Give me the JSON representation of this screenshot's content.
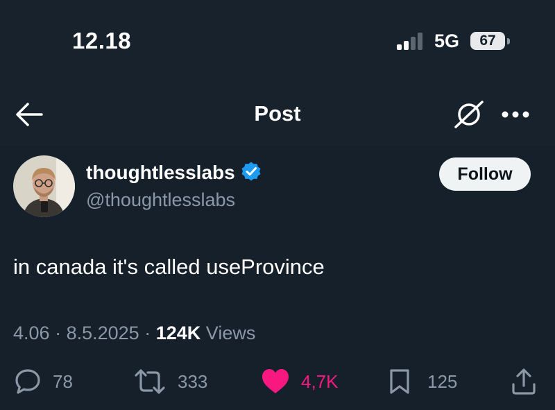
{
  "status_bar": {
    "time": "12.18",
    "network": "5G",
    "battery": "67"
  },
  "header": {
    "title": "Post",
    "back_icon": "arrow-left-icon",
    "grok_icon": "grok-icon",
    "more_icon": "ellipsis-icon"
  },
  "author": {
    "display_name": "thoughtlesslabs",
    "handle": "@thoughtlesslabs",
    "verified": true,
    "follow_label": "Follow"
  },
  "tweet": {
    "text": "in canada it's called useProvince"
  },
  "meta": {
    "time": "4.06",
    "date": "8.5.2025",
    "views_count": "124K",
    "views_label": "Views"
  },
  "actions": {
    "replies": "78",
    "reposts": "333",
    "likes": "4,7K",
    "bookmarks": "125"
  },
  "colors": {
    "background": "#15202b",
    "like": "#f91880",
    "verified": "#1d9bf0",
    "muted": "#8b98a5"
  }
}
